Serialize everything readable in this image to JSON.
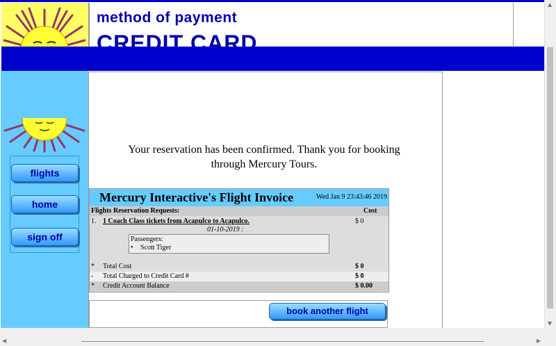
{
  "banner": {
    "title": "method of payment",
    "subtitle": "CREDIT CARD"
  },
  "nav": {
    "flights": "flights",
    "home": "home",
    "signoff": "sign off"
  },
  "confirmation": {
    "message": "Your reservation has been confirmed. Thank you for booking through Mercury Tours."
  },
  "invoice": {
    "title": "Mercury Interactive's Flight Invoice",
    "date": "Wed Jan 9 23:43:46 2019",
    "requests_header": "Flights Reservation Requests:",
    "cost_header": "Cost",
    "item_number": "1.",
    "item_description": "1 Coach Class tickets from Acapulco to Acapulco.",
    "item_date": "01-10-2019 :",
    "item_cost": "$ 0",
    "passengers_label": "Passengers:",
    "passengers": [
      "Scott Tiger"
    ],
    "totals": [
      {
        "marker": "*",
        "label": "Total Cost",
        "value": "$ 0"
      },
      {
        "marker": "-",
        "label": "Total Charged to Credit Card #",
        "value": "$ 0"
      },
      {
        "marker": "*",
        "label": "Credit Account Balance",
        "value": "$ 0.00"
      }
    ]
  },
  "book_button": "book another flight",
  "colors": {
    "brand_blue": "#0000cc",
    "nav_bg": "#66ccff",
    "sun_yellow": "#ffff66",
    "ray_purple": "#993366"
  }
}
